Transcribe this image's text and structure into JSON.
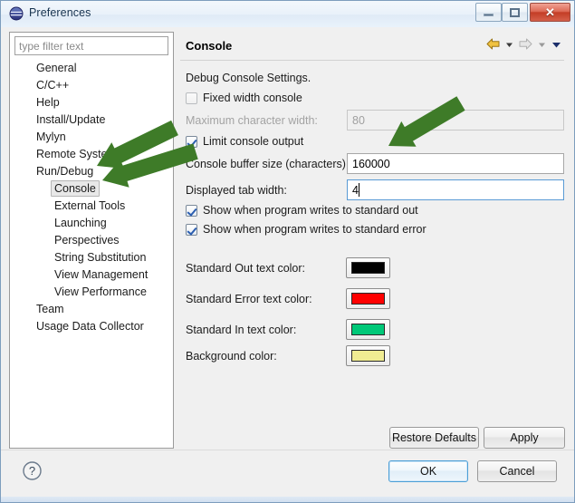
{
  "window": {
    "title": "Preferences",
    "app_icon": "eclipse-globe-icon",
    "controls": {
      "minimize": "minimize-icon",
      "maximize": "maximize-icon",
      "close": "✕"
    }
  },
  "sidebar": {
    "filter": {
      "value": "",
      "placeholder": "type filter text"
    },
    "items": [
      {
        "label": "General",
        "level": 0,
        "selected": false
      },
      {
        "label": "C/C++",
        "level": 0,
        "selected": false
      },
      {
        "label": "Help",
        "level": 0,
        "selected": false
      },
      {
        "label": "Install/Update",
        "level": 0,
        "selected": false
      },
      {
        "label": "Mylyn",
        "level": 0,
        "selected": false
      },
      {
        "label": "Remote Systems",
        "level": 0,
        "selected": false
      },
      {
        "label": "Run/Debug",
        "level": 0,
        "selected": false
      },
      {
        "label": "Console",
        "level": 1,
        "selected": true
      },
      {
        "label": "External Tools",
        "level": 1,
        "selected": false
      },
      {
        "label": "Launching",
        "level": 1,
        "selected": false
      },
      {
        "label": "Perspectives",
        "level": 1,
        "selected": false
      },
      {
        "label": "String Substitution",
        "level": 1,
        "selected": false
      },
      {
        "label": "View Management",
        "level": 1,
        "selected": false
      },
      {
        "label": "View Performance",
        "level": 1,
        "selected": false
      },
      {
        "label": "Team",
        "level": 0,
        "selected": false
      },
      {
        "label": "Usage Data Collector",
        "level": 0,
        "selected": false
      }
    ]
  },
  "page": {
    "title": "Console",
    "nav": {
      "back_icon": "back-arrow-icon",
      "back_menu_icon": "chevron-down-icon",
      "forward_icon": "forward-arrow-icon",
      "forward_menu_icon": "chevron-down-icon",
      "menu_icon": "chevron-down-icon"
    },
    "group_label": "Debug Console Settings.",
    "fixed_width_console": {
      "label": "Fixed width console",
      "checked": false
    },
    "max_char_width": {
      "label": "Maximum character width:",
      "value": "80",
      "enabled": false
    },
    "limit_console_output": {
      "label": "Limit console output",
      "checked": true
    },
    "buffer_size": {
      "label": "Console buffer size (characters):",
      "value": "160000"
    },
    "tab_width": {
      "label": "Displayed tab width:",
      "value": "4",
      "focused": true
    },
    "show_stdout": {
      "label": "Show when program writes to standard out",
      "checked": true
    },
    "show_stderr": {
      "label": "Show when program writes to standard error",
      "checked": true
    },
    "colors": [
      {
        "label": "Standard Out text color:",
        "color": "#000000",
        "name": "standard-out-color-swatch"
      },
      {
        "label": "Standard Error text color:",
        "color": "#FF0000",
        "name": "standard-error-color-swatch"
      },
      {
        "label": "Standard In text color:",
        "color": "#00C878",
        "name": "standard-in-color-swatch"
      },
      {
        "label": "Background color:",
        "color": "#F0EC92",
        "name": "background-color-swatch"
      }
    ],
    "restore_defaults_label": "Restore Defaults",
    "apply_label": "Apply"
  },
  "footer": {
    "help_icon": "help-question-icon",
    "ok_label": "OK",
    "cancel_label": "Cancel"
  },
  "annotations": {
    "arrow_color": "#3E7B28",
    "count": 3,
    "targets": [
      "Console tree item",
      "Console tree item",
      "Console buffer size field"
    ]
  }
}
